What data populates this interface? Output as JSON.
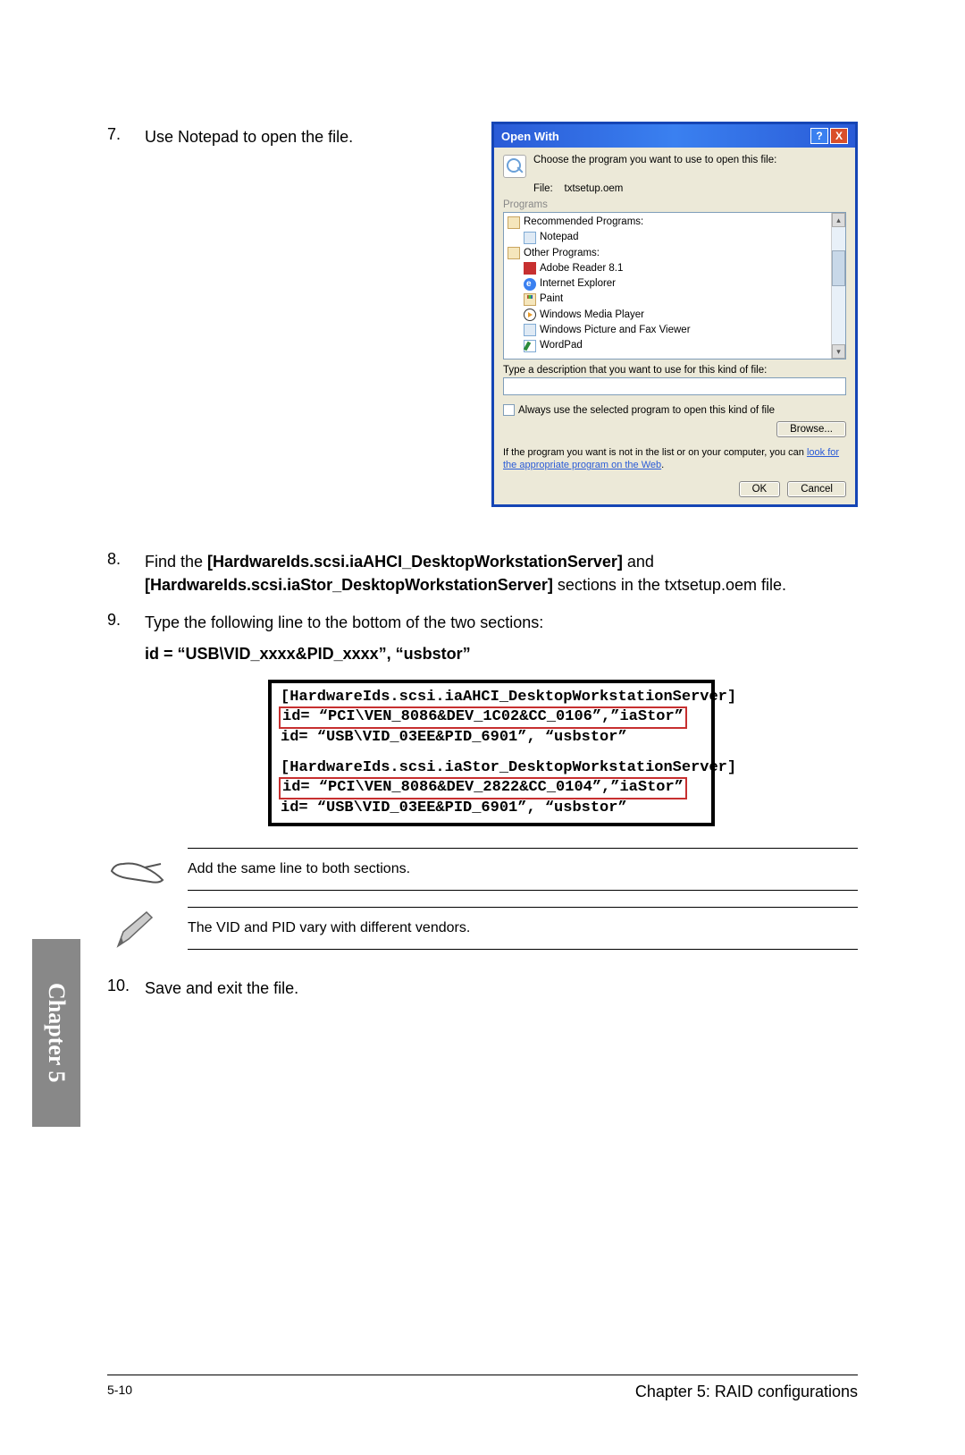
{
  "steps": {
    "s7": {
      "num": "7.",
      "text": "Use Notepad to open the file."
    },
    "s8": {
      "num": "8.",
      "prefix": "Find the ",
      "bold1": "[HardwareIds.scsi.iaAHCI_DesktopWorkstationServer]",
      "mid1": " and ",
      "bold2": "[HardwareIds.scsi.iaStor_DesktopWorkstationServer]",
      "suffix": " sections in the txtsetup.oem file."
    },
    "s9": {
      "num": "9.",
      "text": "Type the following line to the bottom of the two sections:"
    },
    "s9_code": "id = “USB\\VID_xxxx&PID_xxxx”, “usbstor”",
    "s10": {
      "num": "10.",
      "text": "Save and exit the file."
    }
  },
  "dialog": {
    "title": "Open With",
    "msg": "Choose the program you want to use to open this file:",
    "file_label": "File:",
    "file_name": "txtsetup.oem",
    "programs_label": "Programs",
    "cat_recommended": "Recommended Programs:",
    "cat_other": "Other Programs:",
    "items": {
      "notepad": "Notepad",
      "adobe": "Adobe Reader 8.1",
      "ie": "Internet Explorer",
      "paint": "Paint",
      "wmp": "Windows Media Player",
      "picfax": "Windows Picture and Fax Viewer",
      "wordpad": "WordPad"
    },
    "desc_label": "Type a description that you want to use for this kind of file:",
    "checkbox_label": "Always use the selected program to open this kind of file",
    "browse_btn": "Browse...",
    "link_prefix": "If the program you want is not in the list or on your computer, you can ",
    "link_text": "look for the appropriate program on the Web",
    "link_suffix": ".",
    "ok_btn": "OK",
    "cancel_btn": "Cancel"
  },
  "codebox": {
    "sec1_line1": "[HardwareIds.scsi.iaAHCI_DesktopWorkstationServer]",
    "sec1_id": "id= “PCI\\VEN_8086&DEV_1C02&CC_0106”,”iaStor”",
    "sec1_add": "id= “USB\\VID_03EE&PID_6901”, “usbstor”",
    "sec2_line1": "[HardwareIds.scsi.iaStor_DesktopWorkstationServer]",
    "sec2_id": "id= “PCI\\VEN_8086&DEV_2822&CC_0104”,”iaStor”",
    "sec2_add": "id= “USB\\VID_03EE&PID_6901”, “usbstor”"
  },
  "notes": {
    "note1": "Add the same line to both sections.",
    "note2": "The VID and PID vary with different vendors."
  },
  "footer": {
    "page_num": "5-10",
    "chapter_title": "Chapter 5: RAID configurations"
  },
  "chapter_tab": "Chapter 5"
}
